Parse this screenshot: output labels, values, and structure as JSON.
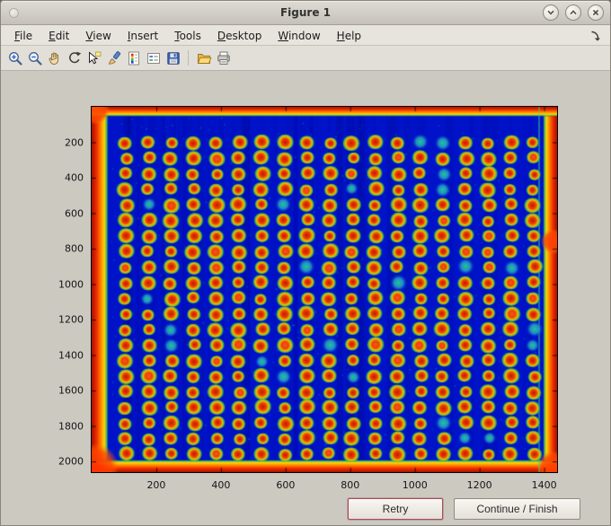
{
  "window": {
    "title": "Figure 1",
    "controls": [
      "shade",
      "maximize",
      "close"
    ]
  },
  "menu": {
    "items": [
      "File",
      "Edit",
      "View",
      "Insert",
      "Tools",
      "Desktop",
      "Window",
      "Help"
    ]
  },
  "toolbar": {
    "buttons": [
      "zoom-in",
      "zoom-out",
      "pan",
      "rotate-3d",
      "data-cursor",
      "brush",
      "insert-colorbar",
      "insert-legend",
      "save",
      "open",
      "print"
    ]
  },
  "buttons": {
    "retry": "Retry",
    "continue": "Continue / Finish"
  },
  "chart_data": {
    "type": "heatmap",
    "title": "",
    "xlabel": "",
    "ylabel": "",
    "x_ticks": [
      200,
      400,
      600,
      800,
      1000,
      1200,
      1400
    ],
    "y_ticks": [
      200,
      400,
      600,
      800,
      1000,
      1200,
      1400,
      1600,
      1800,
      2000
    ],
    "x_range": [
      0,
      1440
    ],
    "y_range": [
      0,
      2060
    ],
    "grid": {
      "rows": 21,
      "cols": 19
    },
    "colors": {
      "background": "#0013c8",
      "spot_core": "#cc1400",
      "spot_ring": "#f0c000",
      "spot_halo": "#3cbe50",
      "edge_band": "#f03000"
    },
    "description": "Microarray-style scan image in jet colormap: deep blue field, 21x19 grid of red spots with yellow-green halos, saturated red-orange bands along all four image edges"
  }
}
